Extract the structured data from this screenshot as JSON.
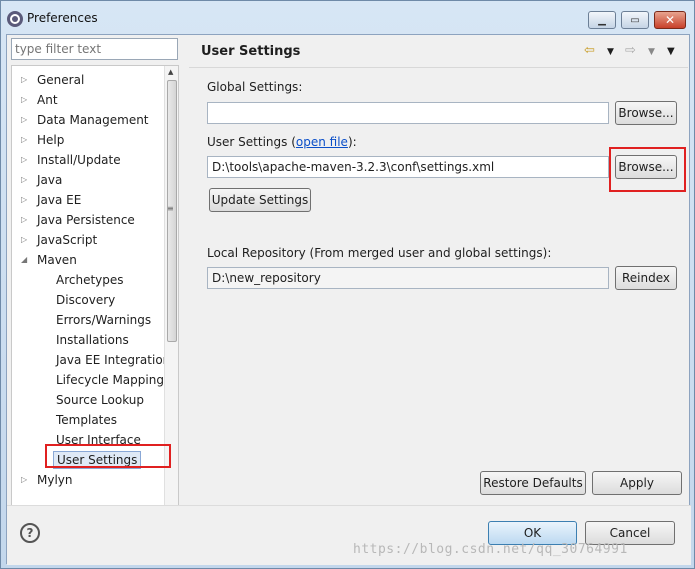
{
  "window": {
    "title": "Preferences"
  },
  "filter": {
    "placeholder": "type filter text"
  },
  "tree": {
    "items": [
      {
        "label": "General",
        "expander": "▷"
      },
      {
        "label": "Ant",
        "expander": "▷"
      },
      {
        "label": "Data Management",
        "expander": "▷"
      },
      {
        "label": "Help",
        "expander": "▷"
      },
      {
        "label": "Install/Update",
        "expander": "▷"
      },
      {
        "label": "Java",
        "expander": "▷"
      },
      {
        "label": "Java EE",
        "expander": "▷"
      },
      {
        "label": "Java Persistence",
        "expander": "▷"
      },
      {
        "label": "JavaScript",
        "expander": "▷"
      },
      {
        "label": "Maven",
        "expander": "◢"
      },
      {
        "label": "Archetypes"
      },
      {
        "label": "Discovery"
      },
      {
        "label": "Errors/Warnings"
      },
      {
        "label": "Installations"
      },
      {
        "label": "Java EE Integration"
      },
      {
        "label": "Lifecycle Mapping"
      },
      {
        "label": "Source Lookup"
      },
      {
        "label": "Templates"
      },
      {
        "label": "User Interface"
      },
      {
        "label": "User Settings"
      },
      {
        "label": "Mylyn",
        "expander": "▷"
      }
    ]
  },
  "page": {
    "title": "User Settings",
    "global_label": "Global Settings:",
    "global_value": "",
    "browse1": "Browse...",
    "user_label_prefix": "User Settings (",
    "open_file": "open file",
    "user_label_suffix": "):",
    "user_value": "D:\\tools\\apache-maven-3.2.3\\conf\\settings.xml",
    "browse2": "Browse...",
    "update": "Update Settings",
    "local_label": "Local Repository (From merged user and global settings):",
    "local_value": "D:\\new_repository",
    "reindex": "Reindex",
    "restore": "Restore Defaults",
    "apply": "Apply"
  },
  "footer": {
    "ok": "OK",
    "cancel": "Cancel"
  },
  "watermark": "https://blog.csdn.net/qq_30764991"
}
